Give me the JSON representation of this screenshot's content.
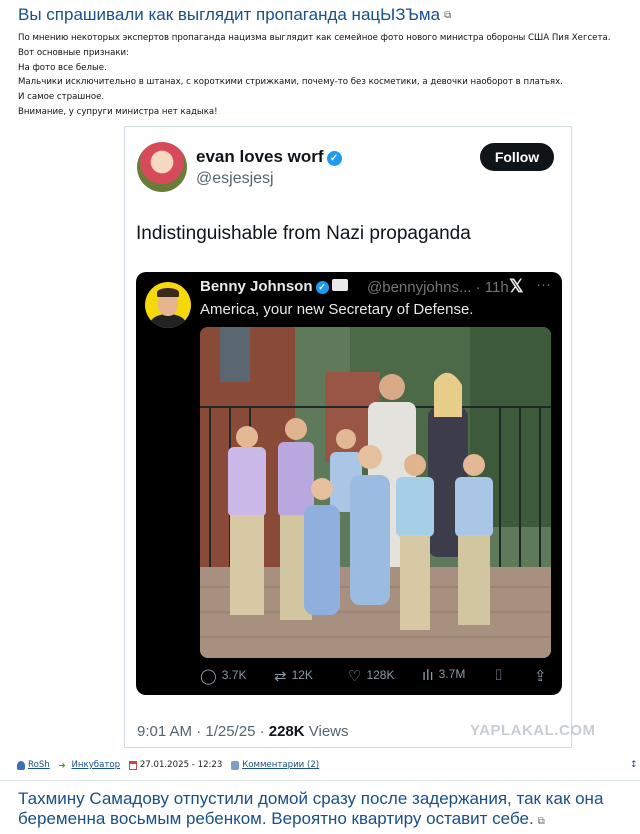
{
  "post": {
    "title": "Вы спрашивали как выглядит пропаганда нацЫЗЪма",
    "body_lines": [
      "По мнению некоторых экспертов пропаганда нацизма выглядит как семейное фото нового министра обороны США Пия Хегсета.",
      "Вот основные признаки:",
      "На фото все белые.",
      "Мальчики исключительно в штанах, с короткими стрижками, почему-то без косметики, а девочки наоборот в платьях.",
      "И самое страшное.",
      "Внимание, у супруги министра нет кадыка!"
    ]
  },
  "tweet": {
    "author_name": "evan loves worf",
    "author_handle": "@esjesjesj",
    "follow_label": "Follow",
    "text": "Indistinguishable from Nazi propaganda",
    "timestamp": "9:01 AM · 1/25/25 · ",
    "views_count": "228K",
    "views_label": " Views",
    "quote": {
      "author_name": "Benny Johnson",
      "author_handle": "@bennyjohns... · 11h",
      "text": "America, your new Secretary of Defense.",
      "actions": {
        "replies": "3.7K",
        "reposts": "12K",
        "likes": "128K",
        "views": "3.7M"
      }
    }
  },
  "watermark": "YAPLAKAL.COM",
  "meta": {
    "author": "RoSh",
    "section": "Инкубатор",
    "date": "27.01.2025 - 12:23",
    "comments": "Комментарии (2)"
  },
  "next_post": {
    "title": "Тахмину Самадову отпустили домой сразу после задержания, так как она беременна восьмым ребенком. Вероятно квартиру оставит себе."
  },
  "colors": {
    "link": "#1a4f88",
    "verified": "#1d9bf0",
    "quote_bg": "#000000"
  }
}
